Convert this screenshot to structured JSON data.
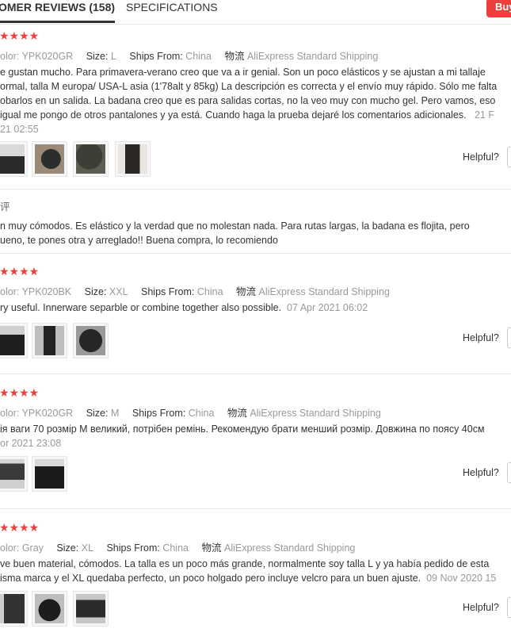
{
  "tabs": {
    "reviews_label": "OMER REVIEWS (158)",
    "specs_label": "SPECIFICATIONS",
    "buy_label": "Buy"
  },
  "stars_glyph": "★★★★",
  "labels": {
    "color": "olor:",
    "size": "Size:",
    "ships_from": "Ships From:",
    "logistics": "物流",
    "helpful": "Helpful?"
  },
  "reviews": [
    {
      "color": "YPK020GR",
      "size": "L",
      "ships_from": "China",
      "shipping": "AliExpress Standard Shipping",
      "lines": [
        "e gustan mucho. Para primavera-verano creo que va a ir genial. Son un poco elásticos y se ajustan a mi tallaje",
        "ormal, talla M europa/ USA-L asia (1'78alt y 85kg) La descripción es correcta y el envío muy rápido. Sólo me falta",
        "obarlos en un salida. La badana creo que es para salidas cortas, no la veo muy con mucho gel. Pero vamos, eso",
        "igual me pongo de otros pantalones y ya está. Cuando haga la prueba dejaré los comentarios adicionales."
      ],
      "date_tail": "21 F",
      "date_line": "21 02:55",
      "followup_tag": "评",
      "followup_lines": [
        "n muy cómodos. Es elástico y la verdad que no molestan nada. Para rutas largas, la badana es flojita, pero",
        "ueno, te pones otra y arreglado!! Buena compra, lo recomiendo"
      ]
    },
    {
      "color": "YPK020BK",
      "size": "XXL",
      "ships_from": "China",
      "shipping": "AliExpress Standard Shipping",
      "lines": [
        "ry useful. Innerware separble or combine together also possible."
      ],
      "date_tail": "07 Apr 2021 06:02"
    },
    {
      "color": "YPK020GR",
      "size": "M",
      "ships_from": "China",
      "shipping": "AliExpress Standard Shipping",
      "lines": [
        "ія ваги 70 розмір M великий, потрібен ремінь. Рекомендую брати менший розмір. Довжина по поясу 40см"
      ],
      "date_line": "or 2021 23:08"
    },
    {
      "color": "Gray",
      "size": "XL",
      "ships_from": "China",
      "shipping": "AliExpress Standard Shipping",
      "lines": [
        "ve buen material, cómodos. La talla es un poco más grande, normalmente soy talla L y ya había pedido de esta",
        "isma marca y el XL quedaba perfecto, un poco holgado pero incluye velcro para un buen ajuste."
      ],
      "date_tail": "09 Nov 2020 15"
    }
  ]
}
